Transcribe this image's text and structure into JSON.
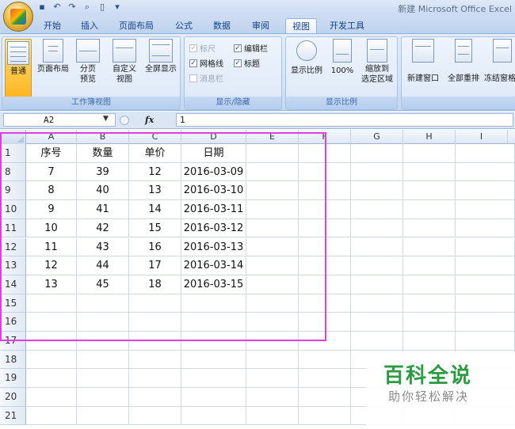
{
  "window_title": "新建 Microsoft Office Excel",
  "quick_access": [
    "save-icon",
    "undo-icon",
    "redo-icon",
    "print-preview-icon",
    "new-document-icon",
    "customize-icon"
  ],
  "tabs": [
    "开始",
    "插入",
    "页面布局",
    "公式",
    "数据",
    "审阅",
    "视图",
    "开发工具"
  ],
  "active_tab": "视图",
  "ribbon": {
    "views_group": {
      "label": "工作簿视图",
      "buttons": [
        "普通",
        "页面布局",
        "分页",
        "预览",
        "自定义",
        "视图",
        "全屏显示"
      ]
    },
    "showhide_group": {
      "label": "显示/隐藏",
      "ruler": "标尺",
      "formula_bar": "编辑栏",
      "gridlines": "网格线",
      "headings": "标题",
      "message_bar": "消息栏"
    },
    "zoom_group": {
      "label": "显示比例",
      "zoom": "显示比例",
      "zoom100": "100%",
      "zoom_selection_1": "缩放到",
      "zoom_selection_2": "选定区域"
    },
    "window_group": {
      "new_window": "新建窗口",
      "arrange_all": "全部重排",
      "freeze": "冻结窗格"
    }
  },
  "formula_bar": {
    "name_box": "A2",
    "fx": "fx",
    "value": "1"
  },
  "columns": [
    "A",
    "B",
    "C",
    "D",
    "E",
    "F",
    "G",
    "H",
    "I"
  ],
  "rows": [
    {
      "num": "1",
      "cells": [
        "序号",
        "数量",
        "单价",
        "日期"
      ]
    },
    {
      "num": "8",
      "cells": [
        "7",
        "39",
        "12",
        "2016-03-09"
      ]
    },
    {
      "num": "9",
      "cells": [
        "8",
        "40",
        "13",
        "2016-03-10"
      ]
    },
    {
      "num": "10",
      "cells": [
        "9",
        "41",
        "14",
        "2016-03-11"
      ]
    },
    {
      "num": "11",
      "cells": [
        "10",
        "42",
        "15",
        "2016-03-12"
      ]
    },
    {
      "num": "12",
      "cells": [
        "11",
        "43",
        "16",
        "2016-03-13"
      ]
    },
    {
      "num": "13",
      "cells": [
        "12",
        "44",
        "17",
        "2016-03-14"
      ]
    },
    {
      "num": "14",
      "cells": [
        "13",
        "45",
        "18",
        "2016-03-15"
      ]
    },
    {
      "num": "15",
      "cells": [
        "",
        "",
        "",
        ""
      ]
    },
    {
      "num": "16",
      "cells": [
        "",
        "",
        "",
        ""
      ]
    },
    {
      "num": "17",
      "cells": [
        "",
        "",
        "",
        ""
      ]
    },
    {
      "num": "18",
      "cells": [
        "",
        "",
        "",
        ""
      ]
    },
    {
      "num": "19",
      "cells": [
        "",
        "",
        "",
        ""
      ]
    },
    {
      "num": "20",
      "cells": [
        "",
        "",
        "",
        ""
      ]
    },
    {
      "num": "21",
      "cells": [
        "",
        "",
        "",
        ""
      ]
    }
  ],
  "watermark": {
    "title": "百科全说",
    "subtitle": "助你轻松解决"
  },
  "colors": {
    "selection_border": "#e23de0",
    "watermark_green": "#2d9b42"
  }
}
